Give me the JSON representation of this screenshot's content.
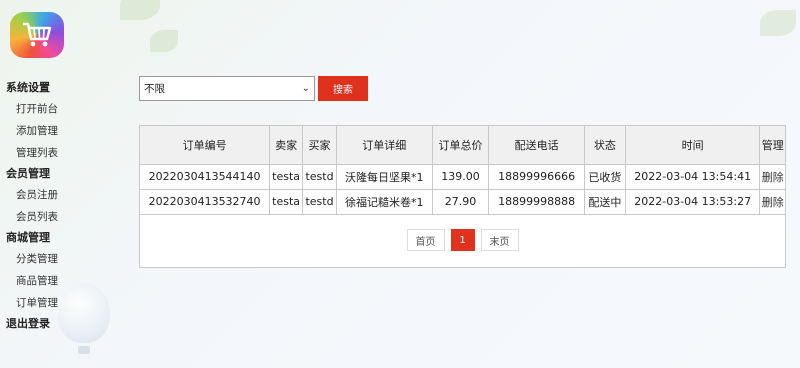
{
  "sidebar": {
    "groups": [
      {
        "title": "系统设置",
        "items": [
          "打开前台",
          "添加管理",
          "管理列表"
        ]
      },
      {
        "title": "会员管理",
        "items": [
          "会员注册",
          "会员列表"
        ]
      },
      {
        "title": "商城管理",
        "items": [
          "分类管理",
          "商品管理",
          "订单管理"
        ]
      }
    ],
    "logout": "退出登录"
  },
  "filter": {
    "selected": "不限",
    "search_label": "搜索"
  },
  "orders": {
    "headers": [
      "订单编号",
      "卖家",
      "买家",
      "订单详细",
      "订单总价",
      "配送电话",
      "状态",
      "时间",
      "管理"
    ],
    "rows": [
      [
        "2022030413544140",
        "testa",
        "testd",
        "沃隆每日坚果*1",
        "139.00",
        "18899996666",
        "已收货",
        "2022-03-04 13:54:41",
        "删除"
      ],
      [
        "2022030413532740",
        "testa",
        "testd",
        "徐福记糙米卷*1",
        "27.90",
        "18899998888",
        "配送中",
        "2022-03-04 13:53:27",
        "删除"
      ]
    ]
  },
  "pager": {
    "first": "首页",
    "current": "1",
    "last": "末页"
  },
  "colors": {
    "accent": "#e0301e"
  },
  "icons": {
    "logo": "shopping-cart-icon",
    "select": "chevron-down-icon"
  }
}
